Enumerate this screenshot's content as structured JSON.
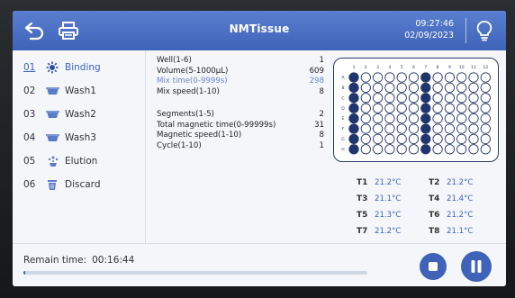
{
  "header": {
    "title": "NMTissue",
    "time": "09:27:46",
    "date": "02/09/2023",
    "icons": [
      "back-icon",
      "printer-icon",
      "bulb-icon"
    ]
  },
  "steps": [
    {
      "num": "01",
      "label": "Binding",
      "icon": "binding-icon",
      "active": true
    },
    {
      "num": "02",
      "label": "Wash1",
      "icon": "tray-icon",
      "active": false
    },
    {
      "num": "03",
      "label": "Wash2",
      "icon": "tray-icon",
      "active": false
    },
    {
      "num": "04",
      "label": "Wash3",
      "icon": "tray-icon",
      "active": false
    },
    {
      "num": "05",
      "label": "Elution",
      "icon": "elution-icon",
      "active": false
    },
    {
      "num": "06",
      "label": "Discard",
      "icon": "trash-icon",
      "active": false
    }
  ],
  "params": {
    "group1": [
      {
        "label": "Well(1-6)",
        "value": "1"
      },
      {
        "label": "Volume(5-1000μL)",
        "value": "609"
      },
      {
        "label": "Mix time(0-9999s)",
        "value": "298",
        "highlight": true
      },
      {
        "label": "Mix speed(1-10)",
        "value": "8"
      }
    ],
    "group2": [
      {
        "label": "Segments(1-5)",
        "value": "2"
      },
      {
        "label": "Total magnetic time(0-99999s)",
        "value": "31"
      },
      {
        "label": "Magnetic speed(1-10)",
        "value": "8"
      },
      {
        "label": "Cycle(1-10)",
        "value": "1"
      }
    ]
  },
  "plate": {
    "rows": [
      "A",
      "B",
      "C",
      "D",
      "E",
      "F",
      "G",
      "H"
    ],
    "cols": [
      "1",
      "2",
      "3",
      "4",
      "5",
      "6",
      "7",
      "8",
      "9",
      "10",
      "11",
      "12"
    ],
    "filled_cols": [
      1,
      7
    ],
    "fill_color": "#1f3570"
  },
  "temps": [
    {
      "label": "T1",
      "value": "21.2°C"
    },
    {
      "label": "T2",
      "value": "21.2°C"
    },
    {
      "label": "T3",
      "value": "21.1°C"
    },
    {
      "label": "T4",
      "value": "21.4°C"
    },
    {
      "label": "T5",
      "value": "21.3°C"
    },
    {
      "label": "T6",
      "value": "21.2°C"
    },
    {
      "label": "T7",
      "value": "21.2°C"
    },
    {
      "label": "T8",
      "value": "21.1°C"
    }
  ],
  "footer": {
    "remain_label": "Remain time:",
    "remain_value": "00:16:44",
    "progress": 0.005,
    "stop_icon": "stop-icon",
    "pause_icon": "pause-icon"
  },
  "colors": {
    "accent": "#3f63b8",
    "header": "#4a70c4"
  }
}
